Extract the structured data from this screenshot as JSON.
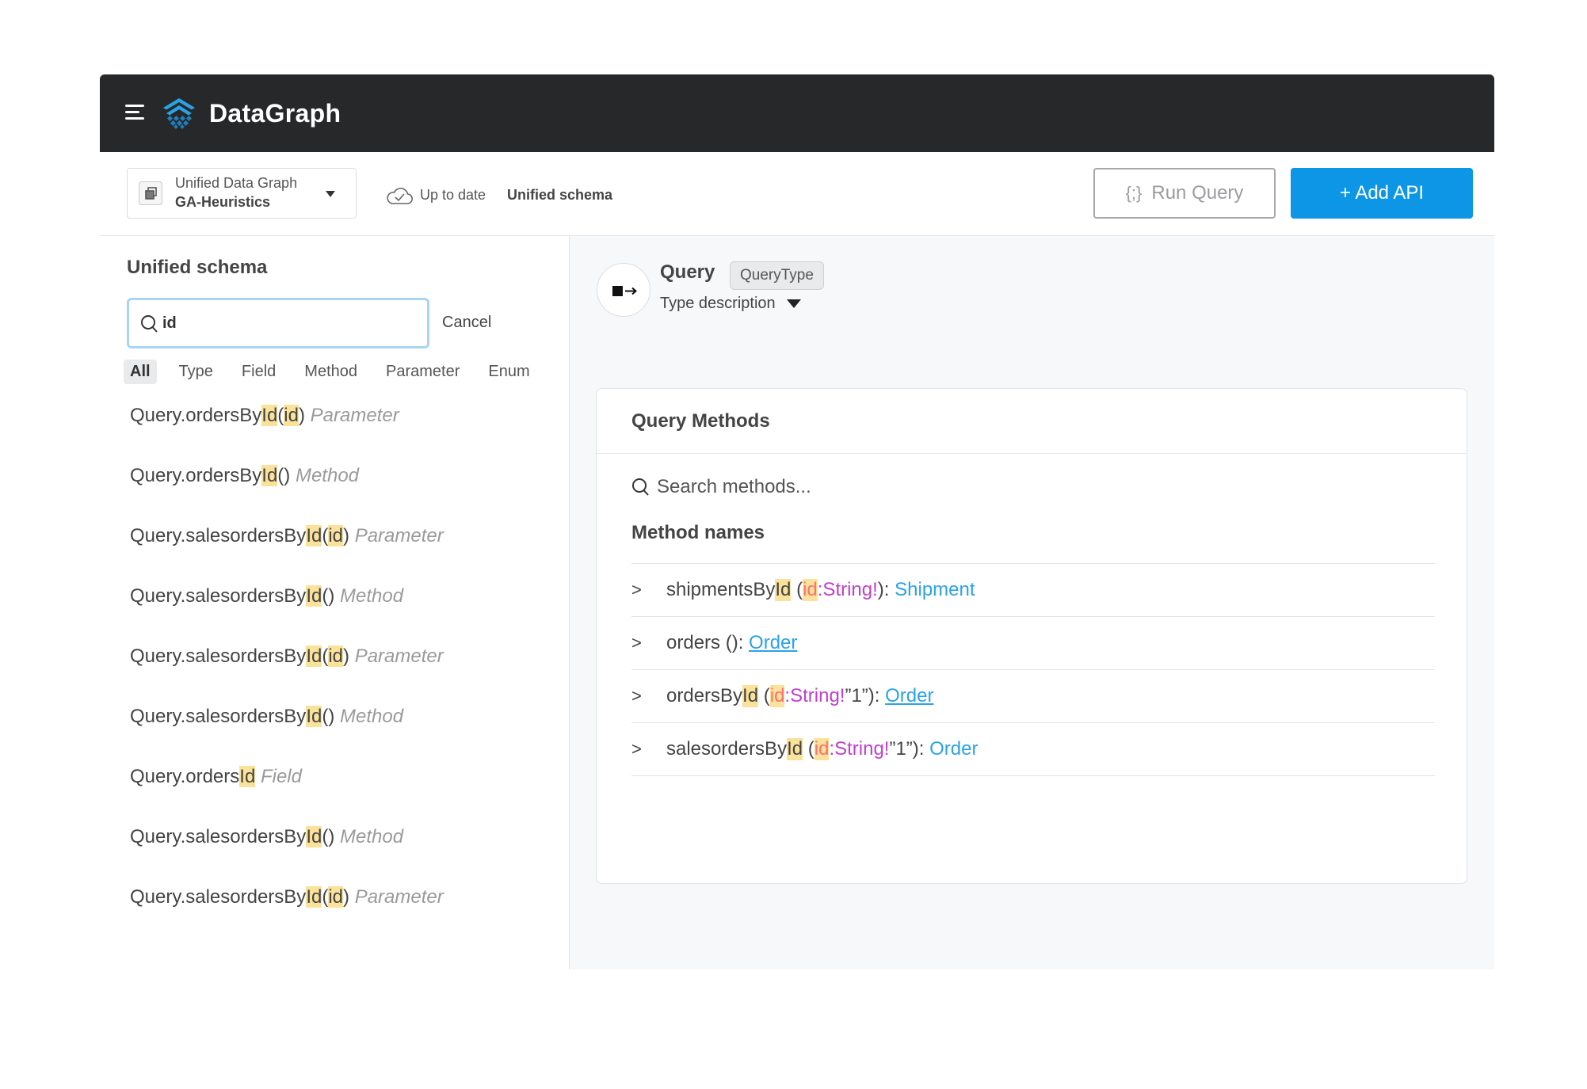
{
  "app": {
    "brand": "DataGraph"
  },
  "toolbar": {
    "graph_label": "Unified Data Graph",
    "graph_name": "GA-Heuristics",
    "status": "Up to date",
    "schema": "Unified schema",
    "run_query_icon": "{;}",
    "run_query": "Run Query",
    "add_api": "+ Add API"
  },
  "sidebar": {
    "title": "Unified schema",
    "search_value": "id",
    "cancel": "Cancel",
    "filters": [
      "All",
      "Type",
      "Field",
      "Method",
      "Parameter",
      "Enum"
    ],
    "active_filter": "All",
    "results": [
      {
        "pre": "Query.ordersBy",
        "hl1": "Id",
        "open": "(",
        "hl2": "id",
        "close": ")",
        "kind": "Parameter"
      },
      {
        "pre": "Query.ordersBy",
        "hl1": "Id",
        "open": "(",
        "hl2": "",
        "close": ")",
        "kind": "Method"
      },
      {
        "pre": "Query.salesordersBy",
        "hl1": "Id",
        "open": "(",
        "hl2": "id",
        "close": ")",
        "kind": "Parameter"
      },
      {
        "pre": "Query.salesordersBy",
        "hl1": "Id",
        "open": "(",
        "hl2": "",
        "close": ")",
        "kind": "Method"
      },
      {
        "pre": "Query.salesordersBy",
        "hl1": "Id",
        "open": "(",
        "hl2": "id",
        "close": ")",
        "kind": "Parameter"
      },
      {
        "pre": "Query.salesordersBy",
        "hl1": "Id",
        "open": "(",
        "hl2": "",
        "close": ")",
        "kind": "Method"
      },
      {
        "pre": "Query.orders",
        "hl1": "Id",
        "open": "",
        "hl2": "",
        "close": "",
        "kind": "Field"
      },
      {
        "pre": "Query.salesordersBy",
        "hl1": "Id",
        "open": "(",
        "hl2": "",
        "close": ")",
        "kind": "Method"
      },
      {
        "pre": "Query.salesordersBy",
        "hl1": "Id",
        "open": "(",
        "hl2": "id",
        "close": ")",
        "kind": "Parameter"
      }
    ]
  },
  "detail": {
    "title": "Query",
    "badge": "QueryType",
    "description_toggle": "Type description",
    "card_title": "Query Methods",
    "search_placeholder": "Search methods...",
    "list_title": "Method names",
    "methods": [
      {
        "chev": ">",
        "name": "shipmentsBy",
        "hl": "Id",
        "open": " (",
        "param": "id",
        "ptype": ":String!",
        "tail": "): ",
        "ret": "Shipment",
        "underline": false
      },
      {
        "chev": ">",
        "name": "orders",
        "hl": "",
        "open": " (",
        "param": "",
        "ptype": "",
        "tail": "): ",
        "ret": "Order",
        "underline": true
      },
      {
        "chev": ">",
        "name": "ordersBy",
        "hl": "Id",
        "open": " (",
        "param": "id",
        "ptype": ":String!",
        "tail": "”1”): ",
        "ret": "Order",
        "underline": true
      },
      {
        "chev": ">",
        "name": "salesordersBy",
        "hl": "Id",
        "open": " (",
        "param": "id",
        "ptype": ":String!",
        "tail": "”1”): ",
        "ret": "Order",
        "underline": false
      }
    ]
  },
  "colors": {
    "header_bg": "#27282a",
    "accent": "#0d96e6",
    "highlight": "#fbe29a",
    "param_id": "#ff7070",
    "param_type": "#c03fcf",
    "return_type": "#2aa3e6"
  },
  "icons": {
    "menu": "hamburger-icon",
    "logo": "datagraph-logo-icon",
    "graph": "graph-copy-icon",
    "dropdown": "caret-down-icon",
    "status": "cloud-check-icon",
    "search": "search-icon",
    "query": "query-type-icon",
    "expand": "chevron-right-icon"
  }
}
